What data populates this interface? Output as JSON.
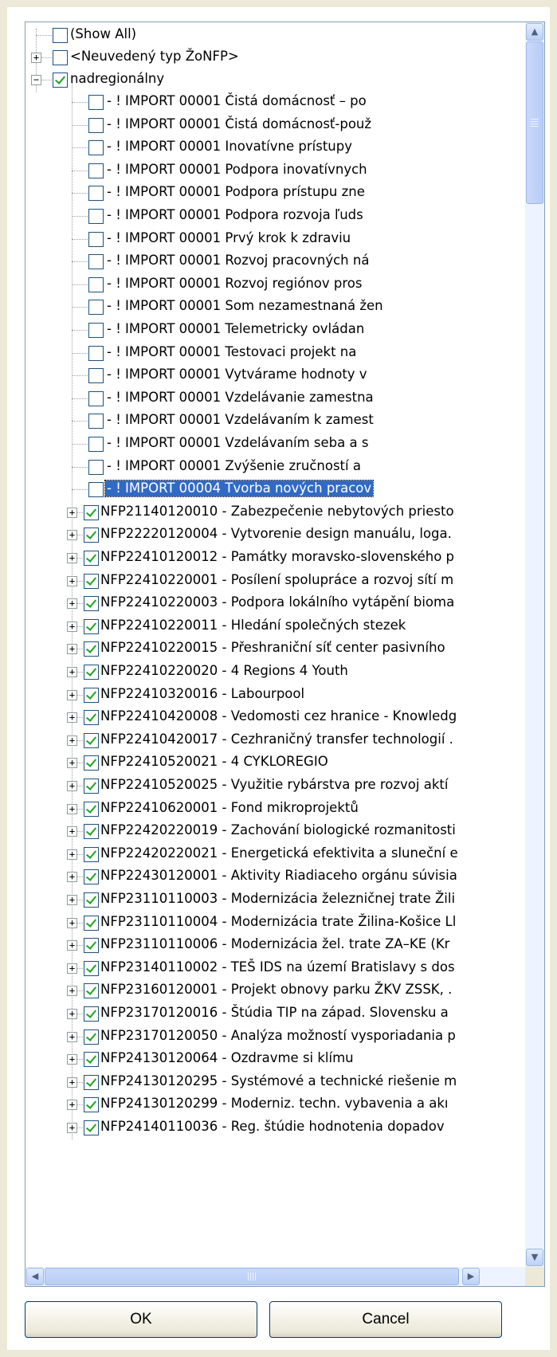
{
  "list": {
    "root": {
      "label": "(Show All)",
      "checked": false
    },
    "groups": [
      {
        "label": "<Neuvedený typ ŽoNFP>",
        "checked": false,
        "expanded": false
      },
      {
        "label": "nadregionálny",
        "checked": true,
        "expanded": true
      }
    ],
    "children": [
      "- ! IMPORT 00001 Čistá domácnosť – po",
      "- ! IMPORT 00001 Čistá domácnosť-použ",
      "- ! IMPORT 00001 Inovatívne prístupy",
      "- ! IMPORT 00001 Podpora inovatívnych",
      "- ! IMPORT 00001 Podpora prístupu zne",
      "- ! IMPORT 00001 Podpora rozvoja ľuds",
      "- ! IMPORT 00001 Prvý krok k zdraviu",
      "- ! IMPORT 00001 Rozvoj pracovných ná",
      "- ! IMPORT 00001 Rozvoj regiónov pros",
      "- ! IMPORT 00001 Som nezamestnaná žen",
      "- ! IMPORT 00001 Telemetricky ovládan",
      "- ! IMPORT 00001 Testovaci projekt na",
      "- ! IMPORT 00001 Vytvárame hodnoty v",
      "- ! IMPORT 00001 Vzdelávanie zamestna",
      "- ! IMPORT 00001 Vzdelávaním k zamest",
      "- ! IMPORT 00001 Vzdelávaním seba a s",
      "- ! IMPORT 00001 Zvýšenie zručností a",
      "- ! IMPORT 00004 Tvorba nových pracov"
    ],
    "selected_child": "- ! IMPORT 00004 Tvorba nových pracov",
    "projects": [
      "NFP21140120010 - Zabezpečenie nebytových priesto",
      "NFP22220120004 - Vytvorenie design manuálu, loga.",
      "NFP22410120012 - Památky moravsko-slovenského p",
      "NFP22410220001 - Posílení spolupráce a rozvoj sítí m",
      "NFP22410220003 - Podpora lokálního vytápění bioma",
      "NFP22410220011 - Hledání společných stezek",
      "NFP22410220015 - Přeshraniční síť center pasivního",
      "NFP22410220020 - 4 Regions 4 Youth",
      "NFP22410320016 - Labourpool",
      "NFP22410420008 - Vedomosti cez hranice - Knowledg",
      "NFP22410420017 - Cezhraničný transfer technologií .",
      "NFP22410520021 - 4 CYKLOREGIO",
      "NFP22410520025 - Využitie rybárstva pre rozvoj aktí",
      "NFP22410620001 - Fond mikroprojektů",
      "NFP22420220019 - Zachování biologické rozmanitosti",
      "NFP22420220021 - Energetická efektivita a sluneční e",
      "NFP22430120001 - Aktivity Riadiaceho orgánu súvisia",
      "NFP23110110003 - Modernizácia železničnej trate Žili",
      "NFP23110110004 - Modernizácia trate Žilina-Košice Ll",
      "NFP23110110006 - Modernizácia žel. trate ZA–KE (Kr",
      "NFP23140110002 - TEŠ IDS na území Bratislavy s dos",
      "NFP23160120001 - Projekt obnovy parku ŽKV ZSSK, .",
      "NFP23170120016 - Štúdia TIP na západ. Slovensku a",
      "NFP23170120050 - Analýza možností vysporiadania p",
      "NFP24130120064 - Ozdravme si klímu",
      "NFP24130120295 - Systémové a technické riešenie m",
      "NFP24130120299 - Moderniz. techn. vybavenia a akı",
      "NFP24140110036 - Reg. štúdie hodnotenia dopadov"
    ]
  },
  "buttons": {
    "ok": "OK",
    "cancel": "Cancel"
  },
  "icons": {
    "expand": "plus-box-icon",
    "collapse": "minus-box-icon",
    "scroll_up": "arrow-up-icon",
    "scroll_down": "arrow-down-icon",
    "scroll_left": "arrow-left-icon",
    "scroll_right": "arrow-right-icon"
  },
  "colors": {
    "selection": "#316ac5",
    "check": "#21a121",
    "border": "#7f9db9",
    "background": "#ece9d8"
  }
}
